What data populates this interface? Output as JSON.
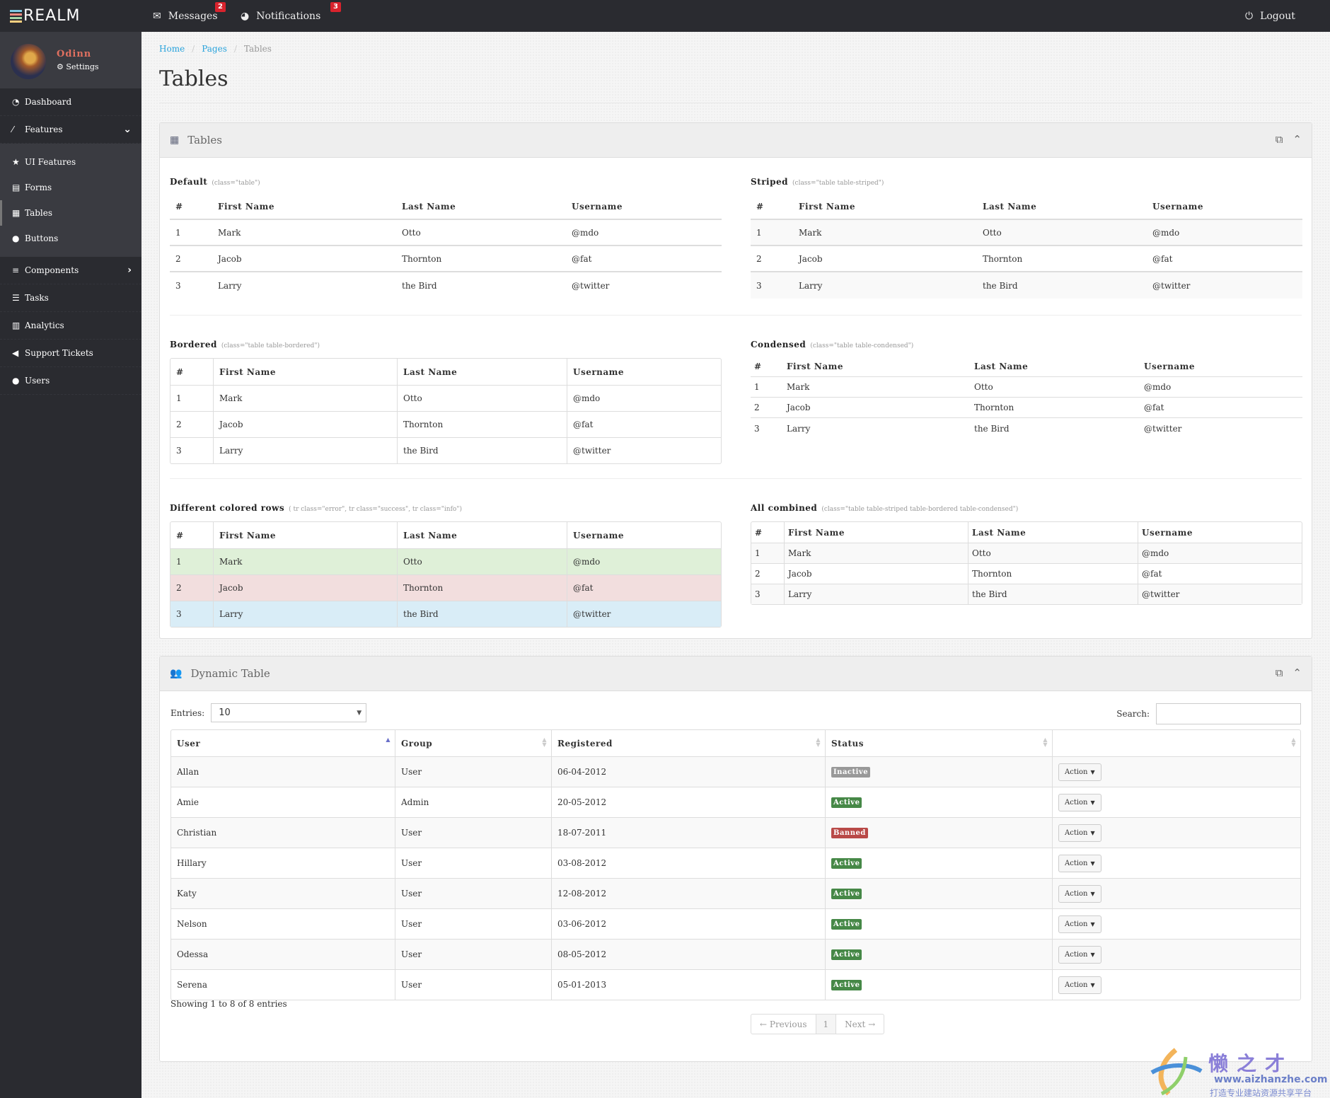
{
  "app": {
    "logo_text": "REALM",
    "logo_bar_colors": [
      "#7ec8e3",
      "#f28b82",
      "#a5d6a7",
      "#ffd180"
    ]
  },
  "topbar": {
    "messages": {
      "label": "Messages",
      "count": "2",
      "icon": "envelope-icon"
    },
    "notifications": {
      "label": "Notifications",
      "count": "3",
      "icon": "globe-icon"
    },
    "logout": {
      "label": "Logout",
      "icon": "power-icon"
    }
  },
  "profile": {
    "name": "Odinn",
    "settings_label": "Settings"
  },
  "sidebar": {
    "items": [
      {
        "label": "Dashboard",
        "icon": "dashboard-icon",
        "glyph": "◔"
      },
      {
        "label": "Features",
        "icon": "magic-wand-icon",
        "glyph": "⁄",
        "expanded": true,
        "chevron": "⌄"
      },
      {
        "label": "Components",
        "icon": "bars-icon",
        "glyph": "≡",
        "chevron": "›"
      },
      {
        "label": "Tasks",
        "icon": "tasks-icon",
        "glyph": "☰"
      },
      {
        "label": "Analytics",
        "icon": "bar-chart-icon",
        "glyph": "▥"
      },
      {
        "label": "Support Tickets",
        "icon": "bullhorn-icon",
        "glyph": "◀"
      },
      {
        "label": "Users",
        "icon": "user-icon",
        "glyph": "●"
      }
    ],
    "sub_items": [
      {
        "label": "UI Features",
        "icon": "star-icon",
        "glyph": "★"
      },
      {
        "label": "Forms",
        "icon": "list-alt-icon",
        "glyph": "▤"
      },
      {
        "label": "Tables",
        "icon": "table-icon",
        "glyph": "▦",
        "active": true
      },
      {
        "label": "Buttons",
        "icon": "circle-icon",
        "glyph": "●"
      }
    ]
  },
  "breadcrumb": {
    "items": [
      "Home",
      "Pages",
      "Tables"
    ],
    "separator": "/"
  },
  "page": {
    "title": "Tables"
  },
  "tables_panel": {
    "title": "Tables",
    "headers": [
      "#",
      "First Name",
      "Last Name",
      "Username"
    ],
    "rows": [
      [
        "1",
        "Mark",
        "Otto",
        "@mdo"
      ],
      [
        "2",
        "Jacob",
        "Thornton",
        "@fat"
      ],
      [
        "3",
        "Larry",
        "the Bird",
        "@twitter"
      ]
    ],
    "sections": {
      "default": {
        "label": "Default",
        "hint": "(class=\"table\")"
      },
      "striped": {
        "label": "Striped",
        "hint": "(class=\"table table-striped\")"
      },
      "bordered": {
        "label": "Bordered",
        "hint": "(class=\"table table-bordered\")"
      },
      "condensed": {
        "label": "Condensed",
        "hint": "(class=\"table table-condensed\")"
      },
      "colored": {
        "label": "Different colored rows",
        "hint": "( tr class=\"error\", tr class=\"success\", tr class=\"info\")",
        "row_colors": [
          "#dff0d8",
          "#f2dede",
          "#d9edf7"
        ]
      },
      "combined": {
        "label": "All combined",
        "hint": "(class=\"table table-striped table-bordered table-condensed\")"
      }
    }
  },
  "dynamic_panel": {
    "title": "Dynamic Table",
    "entries_label": "Entries:",
    "entries_value": "10",
    "search_label": "Search:",
    "search_value": "",
    "headers": [
      "User",
      "Group",
      "Registered",
      "Status",
      ""
    ],
    "rows": [
      {
        "user": "Allan",
        "group": "User",
        "registered": "06-04-2012",
        "status": "Inactive",
        "action": "Action"
      },
      {
        "user": "Amie",
        "group": "Admin",
        "registered": "20-05-2012",
        "status": "Active",
        "action": "Action"
      },
      {
        "user": "Christian",
        "group": "User",
        "registered": "18-07-2011",
        "status": "Banned",
        "action": "Action"
      },
      {
        "user": "Hillary",
        "group": "User",
        "registered": "03-08-2012",
        "status": "Active",
        "action": "Action"
      },
      {
        "user": "Katy",
        "group": "User",
        "registered": "12-08-2012",
        "status": "Active",
        "action": "Action"
      },
      {
        "user": "Nelson",
        "group": "User",
        "registered": "03-06-2012",
        "status": "Active",
        "action": "Action"
      },
      {
        "user": "Odessa",
        "group": "User",
        "registered": "08-05-2012",
        "status": "Active",
        "action": "Action"
      },
      {
        "user": "Serena",
        "group": "User",
        "registered": "05-01-2013",
        "status": "Active",
        "action": "Action"
      }
    ],
    "status_colors": {
      "Inactive": "#999999",
      "Active": "#468847",
      "Banned": "#b94a48"
    },
    "info": "Showing 1 to 8 of 8 entries",
    "pager": {
      "previous": "← Previous",
      "current": "1",
      "next": "Next →"
    }
  },
  "watermark": {
    "title": "懒之才",
    "url": "www.aizhanzhe.com",
    "subtitle": "打造专业建站资源共享平台"
  }
}
